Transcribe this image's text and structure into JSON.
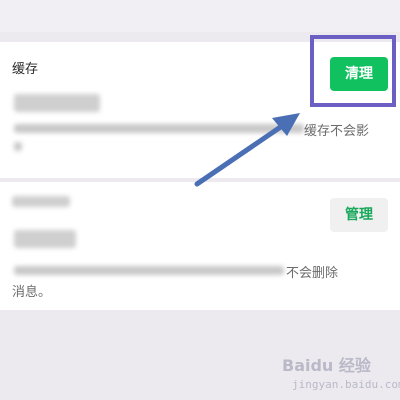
{
  "cache": {
    "title": "缓存",
    "description_tail": "缓存不会影",
    "clean_button": "清理"
  },
  "chat": {
    "description_tail": "不会删除",
    "description_tail2": "消息。",
    "manage_button": "管理"
  },
  "watermark": {
    "brand": "Baidu 经验",
    "url": "jingyan.baidu.com"
  },
  "colors": {
    "primary_green": "#11c160",
    "highlight": "#6c5fc3",
    "arrow": "#4a6fb5"
  }
}
